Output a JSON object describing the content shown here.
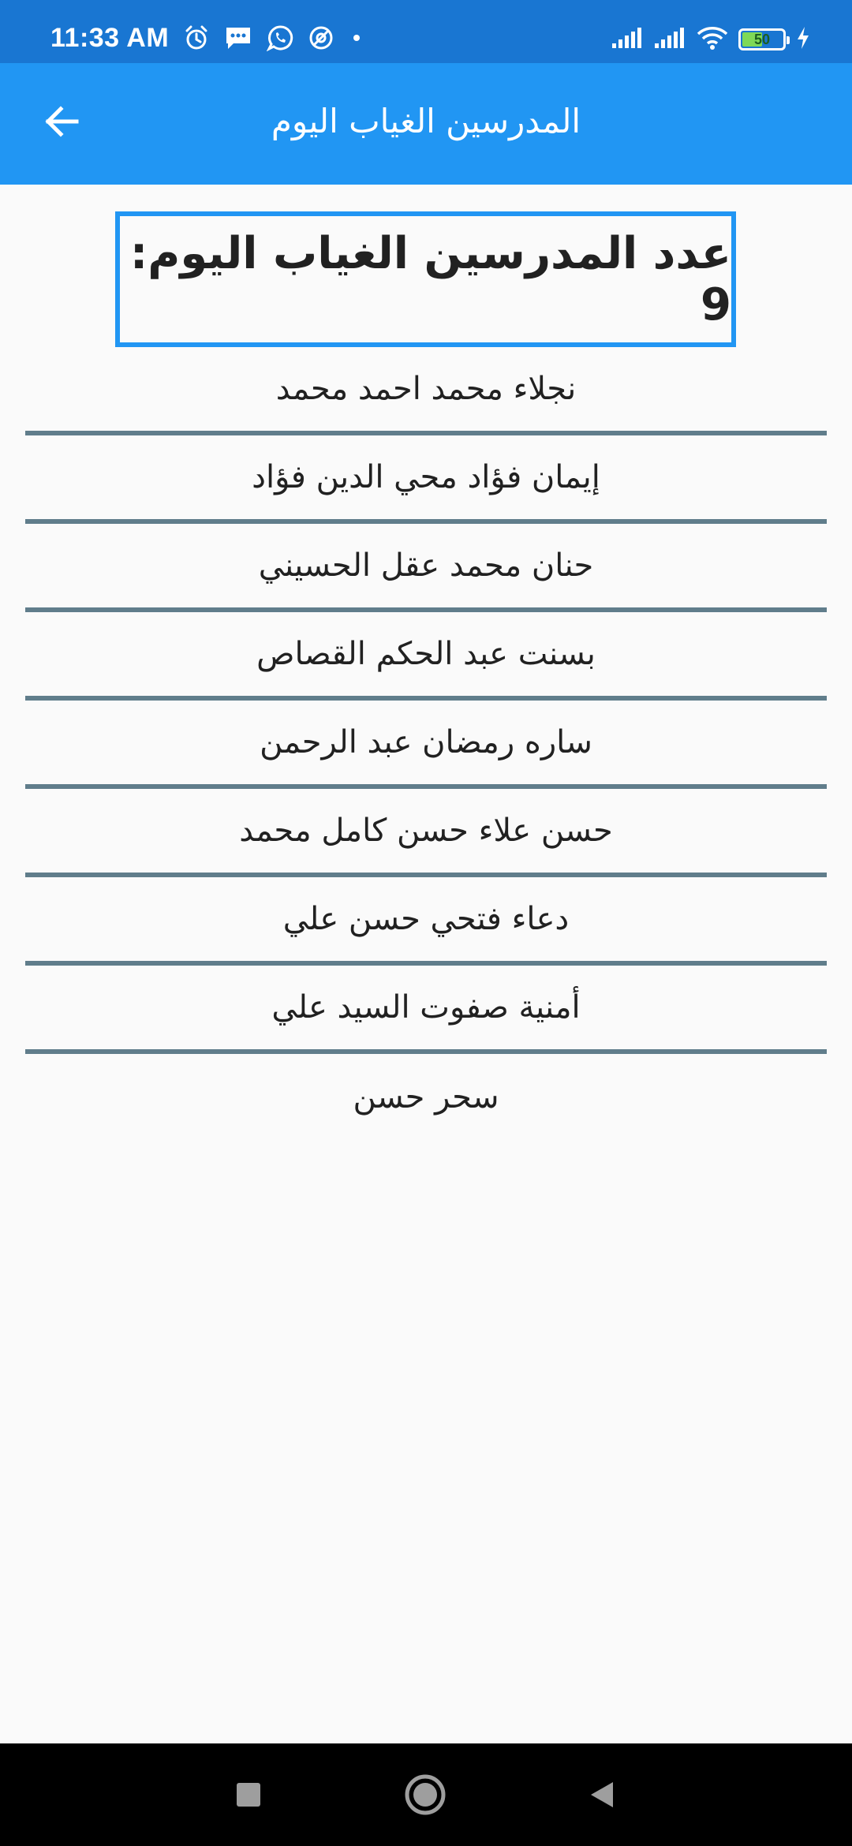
{
  "status_bar": {
    "time": "11:33 AM",
    "battery_level": "50",
    "battery_fraction": 0.5,
    "left_icons": [
      "alarm-icon",
      "message-icon",
      "whatsapp-icon",
      "vpn-icon",
      "dot-icon"
    ],
    "right_icons": [
      "signal-icon",
      "signal-icon",
      "wifi-icon",
      "battery-icon",
      "charging-icon"
    ]
  },
  "app_bar": {
    "title": "المدرسين الغياب اليوم",
    "back_icon": "arrow-back-icon",
    "color": "#2196f3"
  },
  "summary": {
    "text": "عدد المدرسين الغياب اليوم: 9"
  },
  "teachers": [
    "نجلاء محمد احمد محمد",
    "إيمان فؤاد محي الدين فؤاد",
    "حنان محمد عقل الحسيني",
    "بسنت عبد الحكم القصاص",
    "ساره رمضان عبد الرحمن",
    "حسن علاء حسن كامل محمد",
    "دعاء فتحي حسن علي",
    "أمنية صفوت السيد علي",
    "سحر حسن"
  ],
  "nav_bar": {
    "buttons": [
      "recents-square-icon",
      "home-circle-icon",
      "back-triangle-icon"
    ]
  }
}
